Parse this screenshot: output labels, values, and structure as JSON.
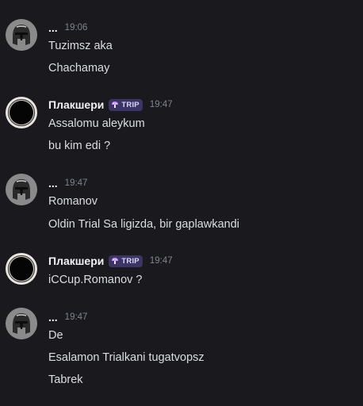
{
  "messages": [
    {
      "user": "...",
      "avatar_icon": "helmet-icon",
      "time": "19:06",
      "lines": [
        "Tuzimsz aka",
        "Chachamay"
      ]
    },
    {
      "user": "Плакшери",
      "avatar_icon": "black-circle-icon",
      "badge": "TRIP",
      "badge_icon": "mushroom-icon",
      "time": "19:47",
      "lines": [
        "Assalomu aleykum",
        "bu kim edi ?"
      ]
    },
    {
      "user": "...",
      "avatar_icon": "helmet-icon",
      "time": "19:47",
      "lines": [
        "Romanov",
        "Oldin Trial Sa ligizda, bir gaplawkandi"
      ]
    },
    {
      "user": "Плакшери",
      "avatar_icon": "black-circle-icon",
      "badge": "TRIP",
      "badge_icon": "mushroom-icon",
      "time": "19:47",
      "lines": [
        "iCCup.Romanov ?"
      ]
    },
    {
      "user": "...",
      "avatar_icon": "helmet-icon",
      "time": "19:47",
      "lines": [
        "De",
        "Esalamon Trialkani tugatvopsz",
        "Tabrek"
      ]
    }
  ],
  "colors": {
    "background": "#1a1a1e",
    "text": "#dbdee1",
    "timestamp": "#80848e",
    "badge_bg": "#3b3566"
  }
}
